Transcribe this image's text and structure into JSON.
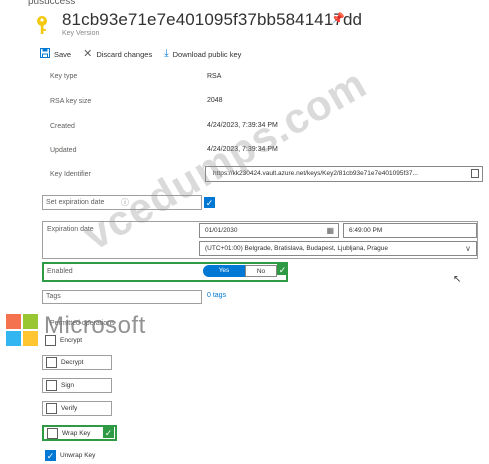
{
  "header": {
    "partial_top_text": "pusuccess",
    "title": "81cb93e71e7e401095f37bb5841417dd",
    "subtitle": "Key Version"
  },
  "toolbar": {
    "save_label": "Save",
    "discard_label": "Discard changes",
    "download_label": "Download public key"
  },
  "properties": {
    "key_type_label": "Key type",
    "key_type_value": "RSA",
    "key_size_label": "RSA key size",
    "key_size_value": "2048",
    "created_label": "Created",
    "created_value": "4/24/2023, 7:39:34 PM",
    "updated_label": "Updated",
    "updated_value": "4/24/2023, 7:39:34 PM",
    "identifier_label": "Key Identifier",
    "identifier_value": "https://kk230424.vault.azure.net/keys/Key2/81cb93e71e7e401095f37..."
  },
  "expiration": {
    "set_label": "Set expiration date",
    "set_checked": true,
    "date_label": "Expiration date",
    "date_value": "01/01/2030",
    "time_value": "6:49:00 PM",
    "timezone_value": "(UTC+01:00) Belgrade, Bratislava, Budapest, Ljubljana, Prague"
  },
  "enabled": {
    "label": "Enabled",
    "yes_label": "Yes",
    "no_label": "No",
    "value": "Yes"
  },
  "tags": {
    "label": "Tags",
    "value": "0 tags"
  },
  "permitted_operations": {
    "label": "Permitted operations",
    "items": [
      {
        "label": "Encrypt",
        "checked": false
      },
      {
        "label": "Decrypt",
        "checked": false
      },
      {
        "label": "Sign",
        "checked": false
      },
      {
        "label": "Verify",
        "checked": false
      },
      {
        "label": "Wrap Key",
        "checked": true
      },
      {
        "label": "Unwrap Key",
        "checked": true
      }
    ]
  },
  "overlays": {
    "watermark_text": "vcedumps.com",
    "logo_word": "Microsoft"
  },
  "colors": {
    "accent": "#0078d4",
    "success": "#2f9a44",
    "key_icon": "#f2c811",
    "ms_red": "#f25022",
    "ms_green": "#7fba00",
    "ms_blue": "#00a4ef",
    "ms_yellow": "#ffb900"
  }
}
